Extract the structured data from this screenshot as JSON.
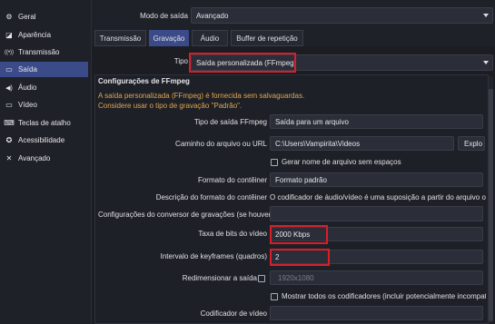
{
  "sidebar": {
    "items": [
      {
        "label": "Geral",
        "icon": "gear-icon",
        "glyph": "⚙"
      },
      {
        "label": "Aparência",
        "icon": "appearance-icon",
        "glyph": "◪"
      },
      {
        "label": "Transmissão",
        "icon": "broadcast-icon",
        "glyph": "((•))"
      },
      {
        "label": "Saída",
        "icon": "output-icon",
        "glyph": "▭"
      },
      {
        "label": "Áudio",
        "icon": "speaker-icon",
        "glyph": "◀)"
      },
      {
        "label": "Vídeo",
        "icon": "video-icon",
        "glyph": "▭"
      },
      {
        "label": "Teclas de atalho",
        "icon": "keyboard-icon",
        "glyph": "⌨"
      },
      {
        "label": "Acessibilidade",
        "icon": "accessibility-icon",
        "glyph": "✪"
      },
      {
        "label": "Avançado",
        "icon": "tools-icon",
        "glyph": "✕"
      }
    ],
    "active_index": 3
  },
  "output_mode": {
    "label": "Modo de saída",
    "value": "Avançado"
  },
  "tabs": [
    {
      "label": "Transmissão"
    },
    {
      "label": "Gravação"
    },
    {
      "label": "Áudio"
    },
    {
      "label": "Buffer de repetição"
    }
  ],
  "active_tab": 1,
  "type": {
    "label": "Tipo",
    "value": "Saída personalizada (FFmpeg)"
  },
  "section_title": "Configurações de FFmpeg",
  "warning": {
    "line1": "A saída personalizada (FFmpeg) é fornecida sem salvaguardas.",
    "line2": "Considere usar o tipo de gravação \"Padrão\"."
  },
  "rows": {
    "ffmpeg_output_type": {
      "label": "Tipo de saída FFmpeg",
      "value": "Saída para um arquivo"
    },
    "file_path": {
      "label": "Caminho do arquivo ou URL",
      "value": "C:\\Users\\Vampirita\\Videos",
      "button": "Explo"
    },
    "no_space_filename": {
      "label": "Gerar nome de arquivo sem espaços"
    },
    "container_format": {
      "label": "Formato do contêiner",
      "value": "Formato padrão"
    },
    "container_desc": {
      "label": "Descrição do formato do contêiner",
      "value": "O codificador de áudio/vídeo é uma suposição a partir do arquivo ou"
    },
    "muxer_settings": {
      "label": "Configurações do conversor de gravações (se houver)",
      "value": ""
    },
    "video_bitrate": {
      "label": "Taxa de bits do vídeo",
      "value": "2000 Kbps"
    },
    "keyframe_interval": {
      "label": "Intervalo de keyframes (quadros)",
      "value": "2"
    },
    "rescale_output": {
      "label": "Redimensionar a saída",
      "value": "1920x1080"
    },
    "show_all_codecs": {
      "label": "Mostrar todos os codificadores (incluir potencialmente incompat"
    },
    "video_encoder": {
      "label": "Codificador de vídeo",
      "value": ""
    }
  },
  "colors": {
    "accent": "#3b4b8a",
    "highlight": "#d91e2a",
    "warning": "#e0a64c",
    "background": "#1f2128"
  }
}
